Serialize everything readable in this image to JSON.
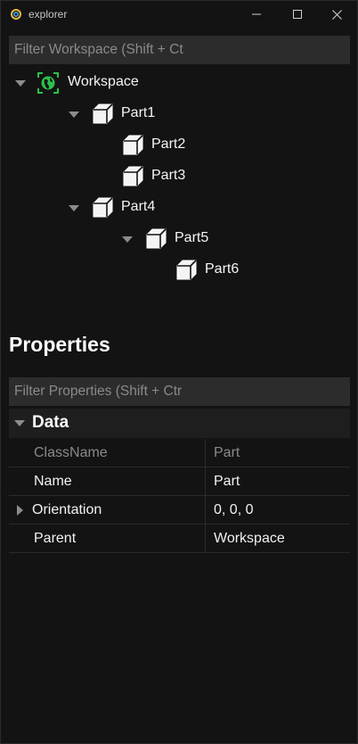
{
  "window": {
    "title": "explorer",
    "icons": {
      "app": "app-logo-icon",
      "minimize": "minimize-icon",
      "maximize": "maximize-icon",
      "close": "close-icon"
    }
  },
  "workspace_filter": {
    "placeholder": "Filter Workspace (Shift + Ct",
    "value": ""
  },
  "tree": {
    "root": {
      "label": "Workspace",
      "icon": "globe-icon",
      "expanded": true
    },
    "part1": {
      "label": "Part1",
      "icon": "cube-icon",
      "expanded": true
    },
    "part2": {
      "label": "Part2",
      "icon": "cube-icon"
    },
    "part3": {
      "label": "Part3",
      "icon": "cube-icon"
    },
    "part4": {
      "label": "Part4",
      "icon": "cube-icon",
      "expanded": true
    },
    "part5": {
      "label": "Part5",
      "icon": "cube-icon",
      "expanded": true
    },
    "part6": {
      "label": "Part6",
      "icon": "cube-icon"
    }
  },
  "properties": {
    "heading": "Properties",
    "filter": {
      "placeholder": "Filter Properties (Shift + Ctr",
      "value": ""
    },
    "section": {
      "title": "Data",
      "expanded": true
    },
    "rows": [
      {
        "name": "ClassName",
        "value": "Part",
        "readonly": true
      },
      {
        "name": "Name",
        "value": "Part"
      },
      {
        "name": "Orientation",
        "value": "0, 0, 0",
        "expandable": true
      },
      {
        "name": "Parent",
        "value": "Workspace"
      }
    ]
  },
  "colors": {
    "background": "#131313",
    "input_bg": "#2c2c2c",
    "accent_green": "#29c24a",
    "muted_text": "#8a8a8a"
  }
}
